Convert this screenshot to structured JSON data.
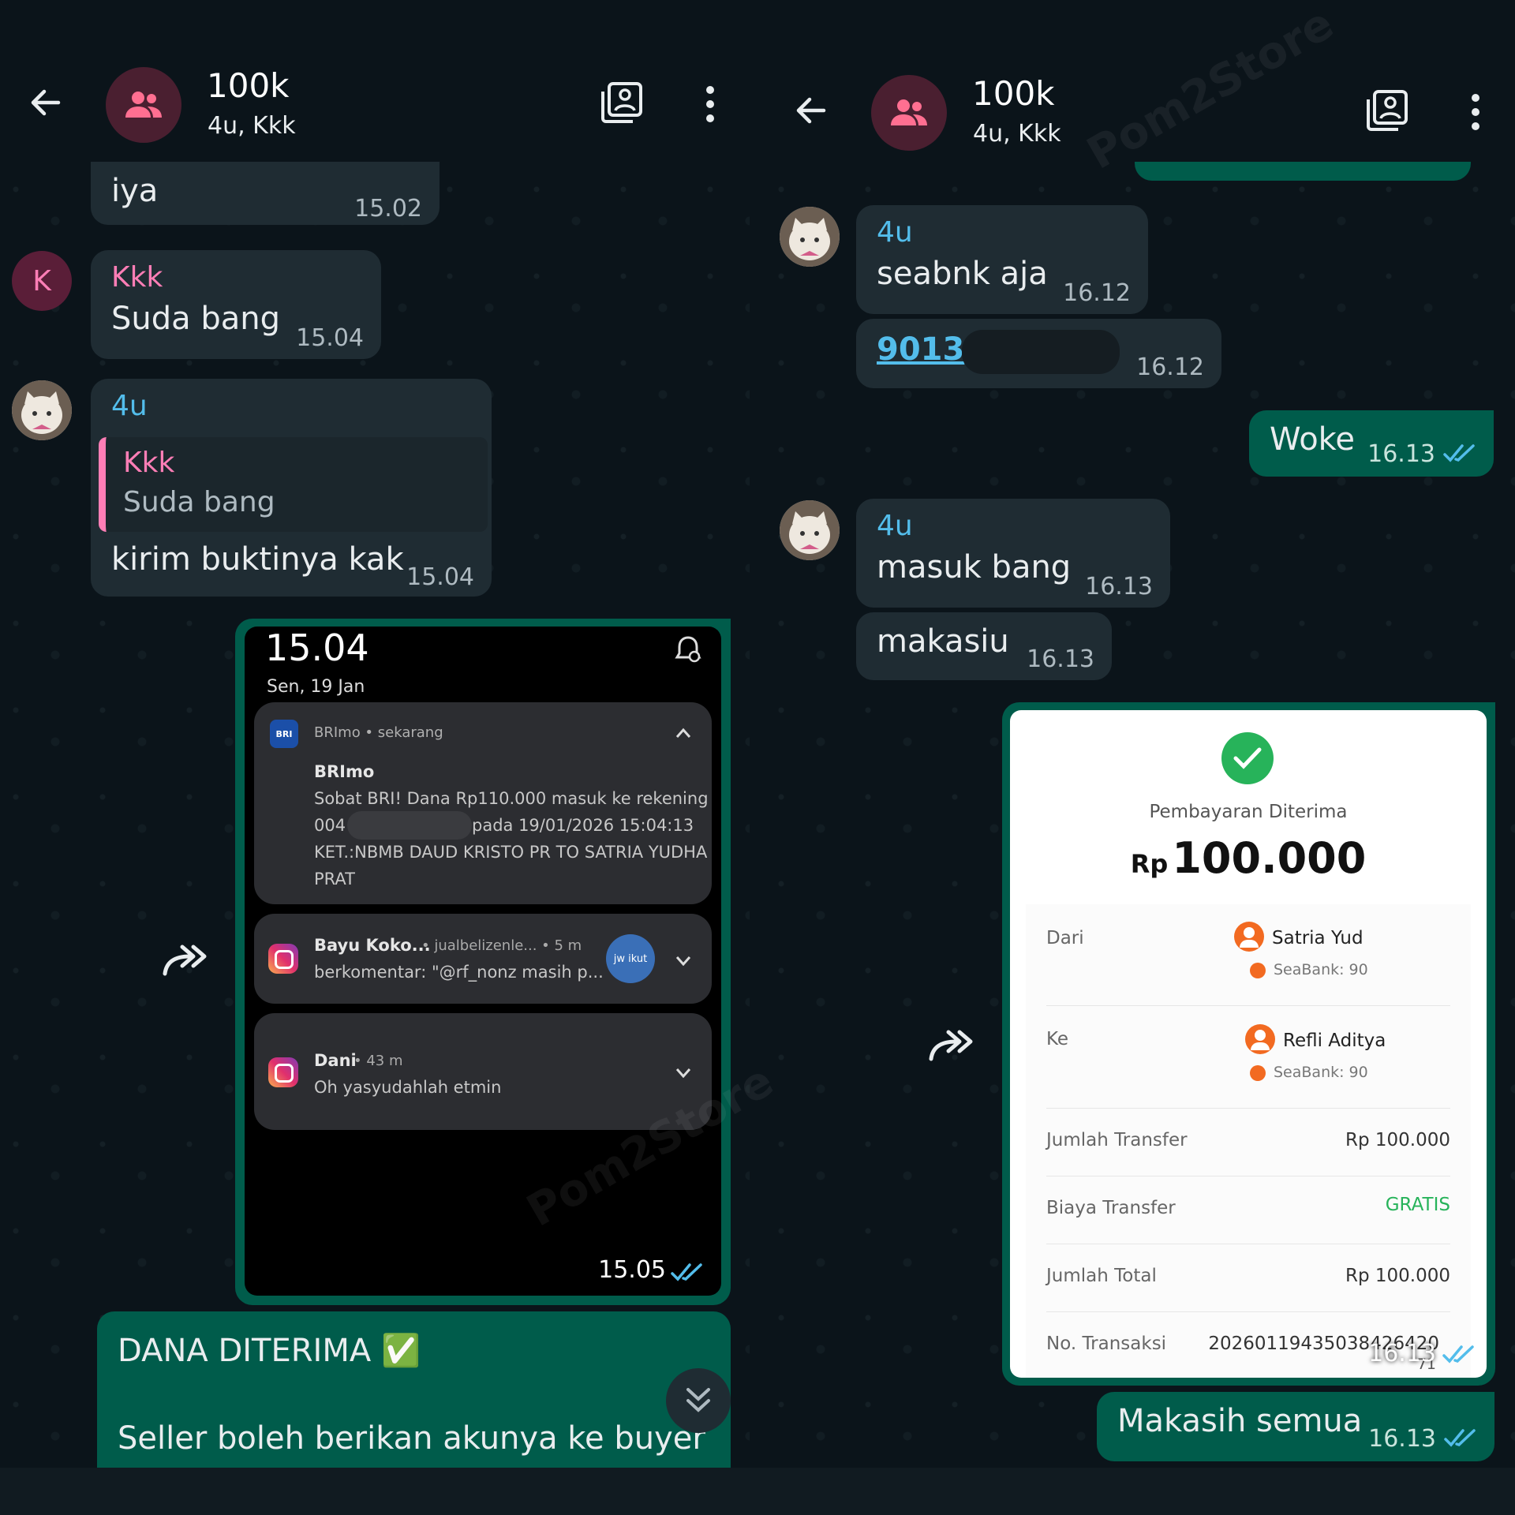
{
  "chat": {
    "title": "100k",
    "members": "4u, Kkk"
  },
  "left": {
    "msg_iya": {
      "text": "iya",
      "time": "15.02"
    },
    "msg_suda": {
      "sender": "Kkk",
      "avatar_letter": "K",
      "text": "Suda bang",
      "time": "15.04"
    },
    "msg_kirim": {
      "sender": "4u",
      "quote_sender": "Kkk",
      "quote_text": "Suda bang",
      "text": "kirim buktinya kak",
      "time": "15.04"
    },
    "screenshot": {
      "clock": "15.04",
      "date": "Sen, 19 Jan",
      "n1": {
        "app": "BRImo",
        "meta": "BRImo • sekarang",
        "title": "BRImo",
        "line1": "Sobat BRI! Dana Rp110.000 masuk ke rekening",
        "line2a": "004",
        "line2b": "pada 19/01/2026 15:04:13",
        "line3": "KET.:NBMB DAUD KRISTO PR TO SATRIA YUDHA",
        "line4": "PRAT"
      },
      "n2": {
        "title": "Bayu Koko...",
        "meta": "• jualbelizenle...  • 5 m",
        "text": "berkomentar: \"@rf_nonz masih p...",
        "thumb": "jw ikut"
      },
      "n3": {
        "title": "Dani",
        "meta": "• 43 m",
        "text": "Oh yasyudahlah etmin"
      },
      "time": "15.05"
    },
    "msg_dana": {
      "text": "DANA DITERIMA ✅",
      "text2": "Seller boleh berikan akunya ke buyer"
    }
  },
  "right": {
    "msg_seabnk": {
      "sender": "4u",
      "text": "seabnk aja",
      "time": "16.12"
    },
    "msg_num": {
      "text": "9013",
      "time": "16.12"
    },
    "msg_woke": {
      "text": "Woke",
      "time": "16.13"
    },
    "msg_masuk": {
      "sender": "4u",
      "text": "masuk bang",
      "time": "16.13"
    },
    "msg_makasiu": {
      "text": "makasiu",
      "time": "16.13"
    },
    "receipt": {
      "title": "Pembayaran Diterima",
      "currency": "Rp",
      "amount": "100.000",
      "from_label": "Dari",
      "from_name": "Satria Yud",
      "from_bank": "SeaBank: 90",
      "to_label": "Ke",
      "to_name": "Refli Aditya",
      "to_bank": "SeaBank: 90",
      "rows": [
        {
          "label": "Jumlah Transfer",
          "value": "Rp 100.000"
        },
        {
          "label": "Biaya Transfer",
          "value": "GRATIS"
        },
        {
          "label": "Jumlah Total",
          "value": "Rp 100.000"
        },
        {
          "label": "No. Transaksi",
          "value": "20260119435038426420"
        }
      ],
      "extra": "71",
      "time": "16.13"
    },
    "msg_makasih": {
      "text": "Makasih semua",
      "time": "16.13"
    }
  },
  "watermark": "Pom2Store",
  "colors": {
    "bg": "#0b141a",
    "incoming": "#1f2c33",
    "outgoing": "#005c4b",
    "sender_4u": "#53bdeb",
    "sender_kkk": "#ff7eb6",
    "read_tick": "#53bdeb",
    "check_green": "#27b35a"
  }
}
